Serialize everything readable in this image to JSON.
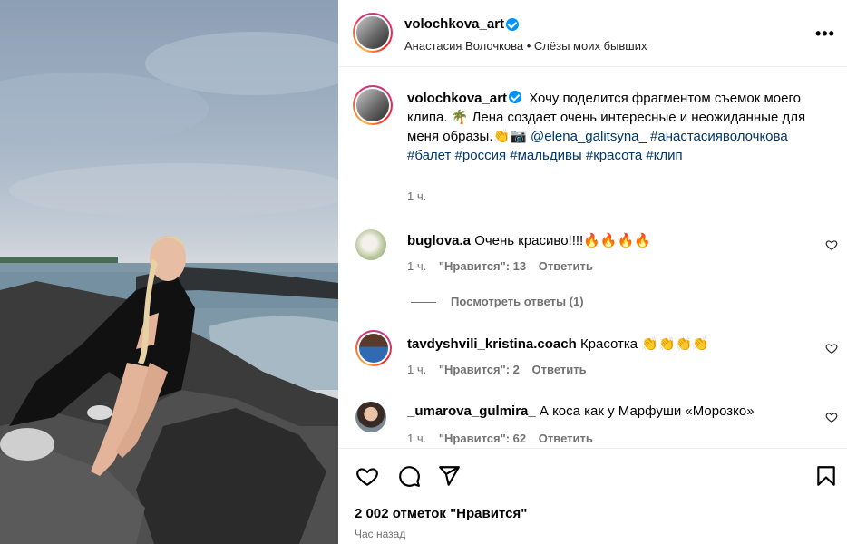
{
  "post": {
    "author": "volochkova_art",
    "subtitle": "Анастасия Волочкова • Слёзы моих бывших",
    "more_icon": "•••",
    "caption": {
      "username": "volochkova_art",
      "text_1": "Хочу поделится фрагментом съемок моего клипа. 🌴 Лена создает очень интересные и неожиданные для меня образы.👏📷",
      "mention": "@elena_galitsyna_",
      "hashtags": "#анастасияволочкова #балет #россия #мальдивы #красота #клип",
      "time": "1 ч."
    }
  },
  "comments": [
    {
      "username": "buglova.a",
      "text": "Очень красиво!!!!🔥🔥🔥🔥",
      "time": "1 ч.",
      "likes": "\"Нравится\": 13",
      "reply": "Ответить"
    },
    {
      "username": "tavdyshvili_kristina.coach",
      "text": "Красотка 👏👏👏👏",
      "time": "1 ч.",
      "likes": "\"Нравится\": 2",
      "reply": "Ответить"
    },
    {
      "username": "_umarova_gulmira_",
      "text": "А коса как у Марфуши «Морозко»",
      "time": "1 ч.",
      "likes": "\"Нравится\": 62",
      "reply": "Ответить"
    }
  ],
  "view_replies": "Посмотреть ответы (1)",
  "footer": {
    "likes": "2 002 отметок \"Нравится\"",
    "time_ago": "Час назад"
  },
  "colors": {
    "verified": "#0095f6",
    "link": "#00376b",
    "muted": "#737373"
  }
}
